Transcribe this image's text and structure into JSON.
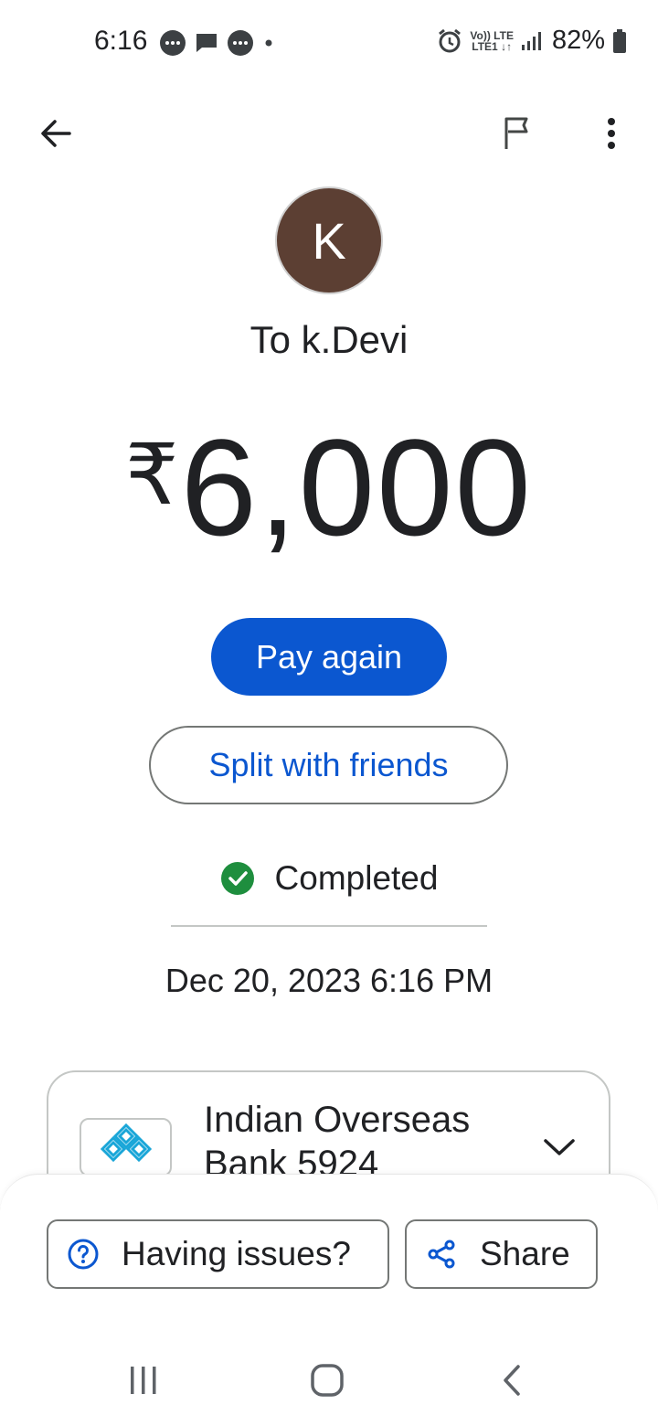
{
  "status_bar": {
    "time": "6:16",
    "battery": "82%",
    "net_top": "Vo)) LTE",
    "net_bottom": "LTE1 ↓↑"
  },
  "app_bar": {
    "back_icon": "arrow-back-icon",
    "flag_icon": "flag-icon",
    "more_icon": "more-vert-icon"
  },
  "recipient": {
    "avatar_letter": "K",
    "avatar_color": "#5c3f33",
    "label": "To k.Devi"
  },
  "amount": {
    "currency": "₹",
    "value": "6,000"
  },
  "actions": {
    "pay_again": "Pay again",
    "split": "Split with friends"
  },
  "transaction": {
    "status": "Completed",
    "status_color": "#1e8e3e",
    "datetime": "Dec 20, 2023 6:16 PM"
  },
  "bank": {
    "name": "Indian Overseas Bank 5924"
  },
  "bottom_actions": {
    "issues": "Having issues?",
    "share": "Share"
  },
  "colors": {
    "accent": "#0b57d0"
  }
}
